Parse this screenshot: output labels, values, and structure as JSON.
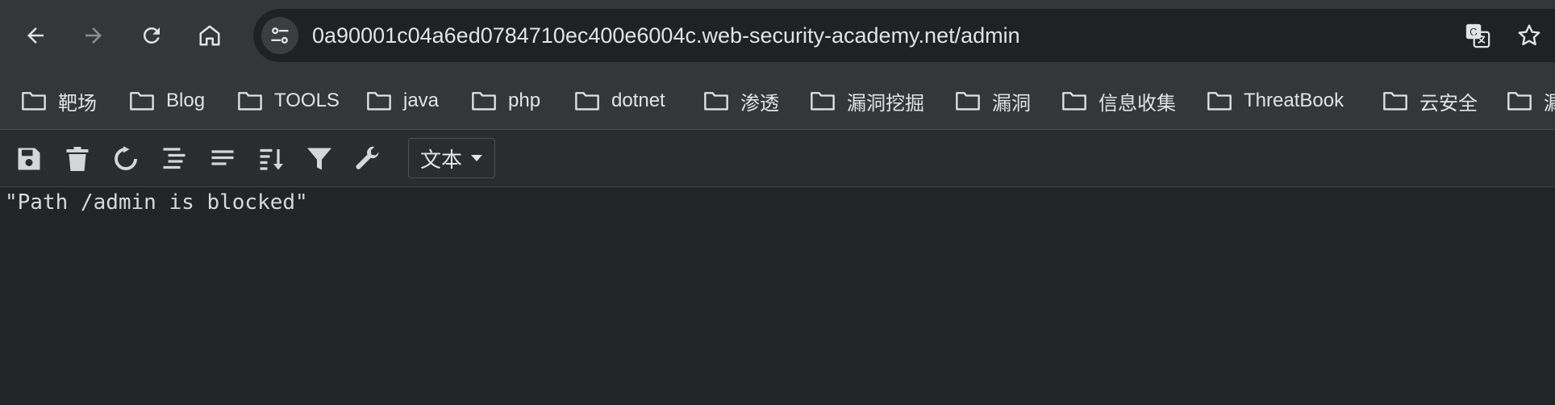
{
  "address_bar": {
    "url": "0a90001c04a6ed0784710ec400e6004c.web-security-academy.net/admin"
  },
  "bookmarks": [
    {
      "label": "靶场"
    },
    {
      "label": "Blog"
    },
    {
      "label": "TOOLS"
    },
    {
      "label": "java"
    },
    {
      "label": "php"
    },
    {
      "label": "dotnet"
    },
    {
      "label": "渗透"
    },
    {
      "label": "漏洞挖掘"
    },
    {
      "label": "漏洞"
    },
    {
      "label": "信息收集"
    },
    {
      "label": "ThreatBook"
    },
    {
      "label": "云安全"
    },
    {
      "label": "漏"
    }
  ],
  "viewer_toolbar": {
    "mode_select": "文本"
  },
  "response": {
    "text": "\"Path /admin is blocked\""
  },
  "colors": {
    "chrome_bg": "#35363a",
    "omnibox_bg": "#202124",
    "page_bg": "#232428",
    "text": "#e3e3e3"
  }
}
